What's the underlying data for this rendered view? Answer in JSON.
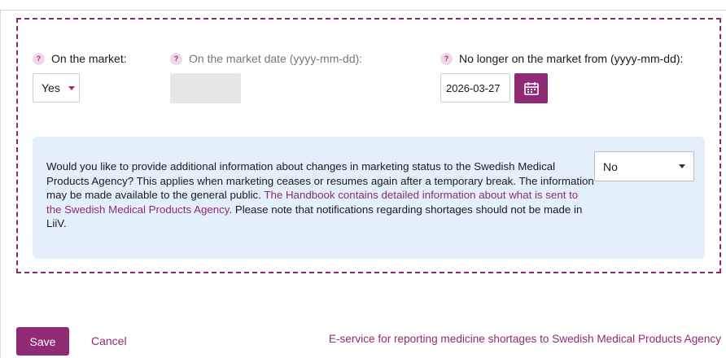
{
  "fields": {
    "on_market": {
      "label": "On the market:",
      "value": "Yes"
    },
    "market_date": {
      "label": "On the market date (yyyy-mm-dd):",
      "value": ""
    },
    "no_longer_on_market": {
      "label": "No longer on the market from (yyyy-mm-dd):",
      "value": "2026-03-27"
    }
  },
  "info": {
    "text_before_link": "Would you like to provide additional information about changes in marketing status to the Swedish Medical Products Agency? This applies when marketing ceases or resumes again after a temporary break. The information may be made available to the general public. ",
    "link_text": "The Handbook contains detailed information about what is sent to the Swedish Medical Products Agency",
    "text_after_link": ". Please note that notifications regarding shortages should not be made in LiiV.",
    "select_value": "No"
  },
  "actions": {
    "save_label": "Save",
    "cancel_label": "Cancel",
    "eservice_link": "E-service for reporting medicine shortages to Swedish Medical Products Agency"
  },
  "icons": {
    "help": "help-icon",
    "calendar": "calendar-icon"
  },
  "colors": {
    "accent": "#8f2a74",
    "info_background": "#e3f0fb",
    "dashed_border": "#8a2a6f"
  }
}
